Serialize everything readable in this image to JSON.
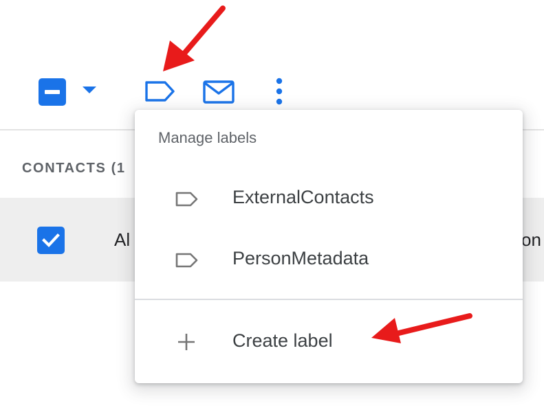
{
  "toolbar": {
    "select_checkbox_state": "indeterminate",
    "icons": [
      "minus-checkbox-icon",
      "caret-down-icon",
      "label-icon",
      "mail-icon",
      "more-vert-icon"
    ]
  },
  "contacts": {
    "heading": "CONTACTS (1",
    "row": {
      "checked": true,
      "name_fragment": "Al",
      "trailing_fragment": "on"
    }
  },
  "menu": {
    "heading": "Manage labels",
    "labels": [
      {
        "name": "ExternalContacts",
        "icon": "label-icon"
      },
      {
        "name": "PersonMetadata",
        "icon": "label-icon"
      }
    ],
    "create": {
      "label": "Create label",
      "icon": "plus-icon"
    }
  },
  "colors": {
    "accent": "#1a73e8",
    "annotation": "#e81b1b",
    "row_highlight": "#eeeeee",
    "menu_text": "#3c4043",
    "muted_text": "#5f6368",
    "label_icon_gray": "#757575"
  }
}
